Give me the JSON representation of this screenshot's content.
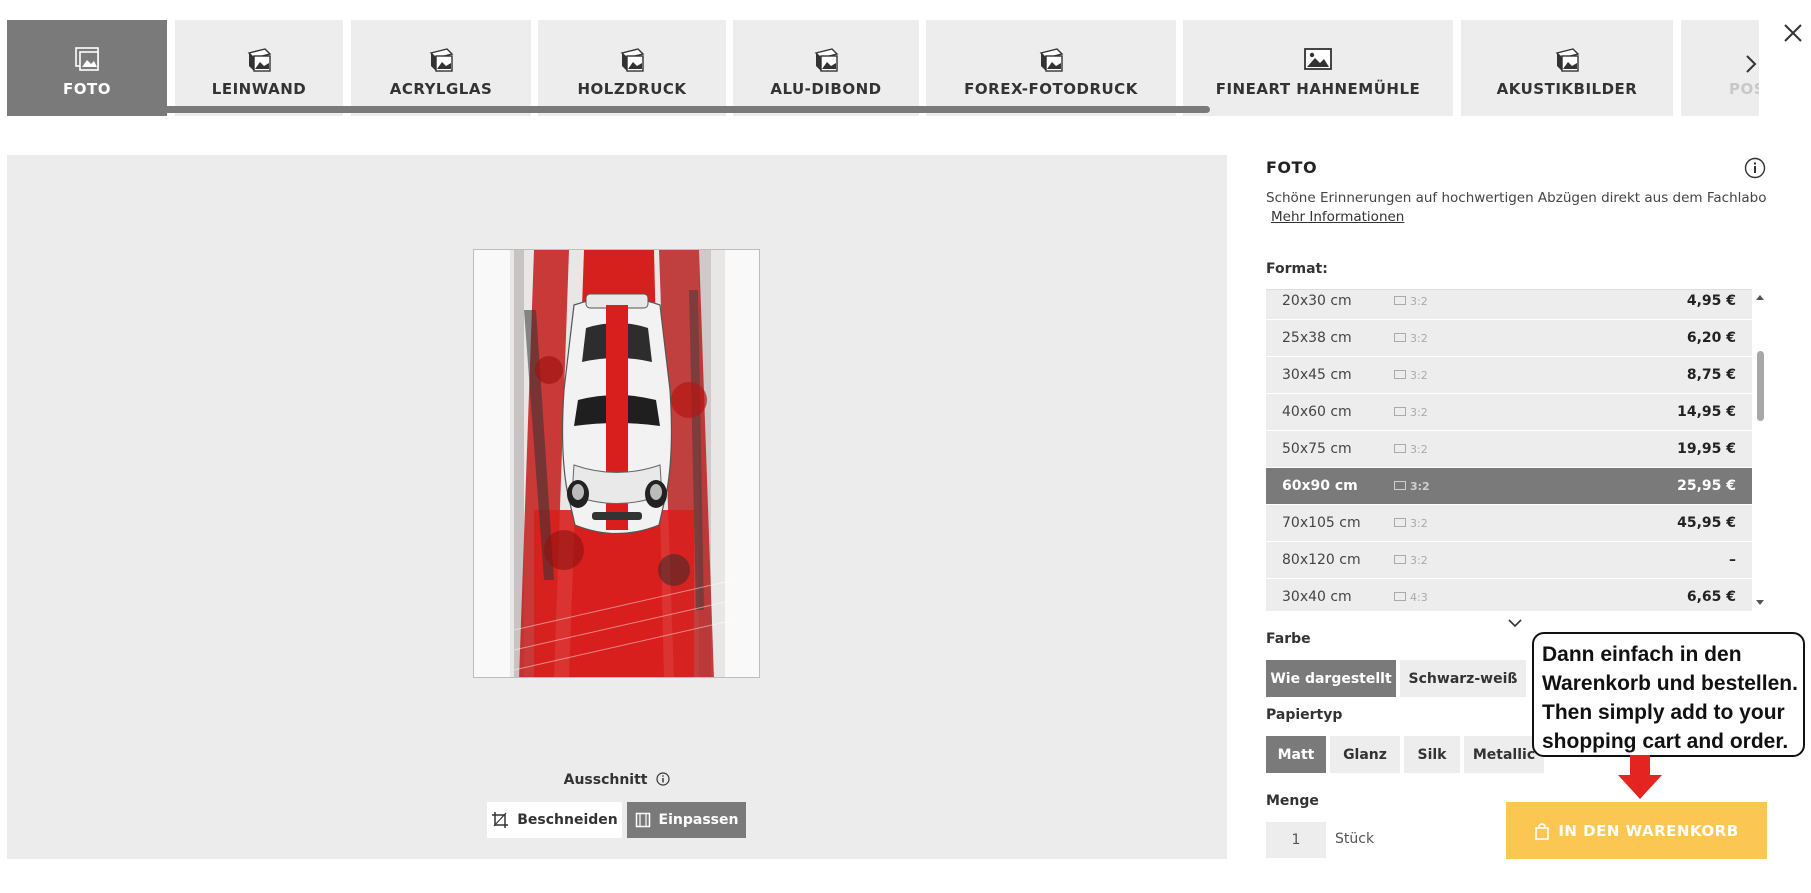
{
  "tabs": [
    {
      "label": "FOTO",
      "icon": "photo-stack-icon",
      "active": true
    },
    {
      "label": "LEINWAND",
      "icon": "canvas-icon"
    },
    {
      "label": "ACRYLGLAS",
      "icon": "acrylic-glass-icon"
    },
    {
      "label": "HOLZDRUCK",
      "icon": "wood-print-icon"
    },
    {
      "label": "ALU-DIBOND",
      "icon": "alu-dibond-icon"
    },
    {
      "label": "FOREX-FOTODRUCK",
      "icon": "forex-print-icon"
    },
    {
      "label": "FINEART HAHNEMÜHLE",
      "icon": "fineart-image-icon"
    },
    {
      "label": "AKUSTIKBILDER",
      "icon": "acoustic-image-icon"
    },
    {
      "label": "POS",
      "icon": "poster-icon"
    }
  ],
  "preview": {
    "crop_section_label": "Ausschnitt",
    "crop_button": "Beschneiden",
    "fit_button": "Einpassen"
  },
  "product": {
    "title": "FOTO",
    "description": "Schöne Erinnerungen auf hochwertigen Abzügen direkt aus dem Fachlabor. ...",
    "more_info": "Mehr Informationen",
    "format_label": "Format:",
    "formats": [
      {
        "size": "20x30 cm",
        "ratio": "3:2",
        "price": "4,95 €"
      },
      {
        "size": "25x38 cm",
        "ratio": "3:2",
        "price": "6,20 €"
      },
      {
        "size": "30x45 cm",
        "ratio": "3:2",
        "price": "8,75 €"
      },
      {
        "size": "40x60 cm",
        "ratio": "3:2",
        "price": "14,95 €"
      },
      {
        "size": "50x75 cm",
        "ratio": "3:2",
        "price": "19,95 €"
      },
      {
        "size": "60x90 cm",
        "ratio": "3:2",
        "price": "25,95 €",
        "selected": true
      },
      {
        "size": "70x105 cm",
        "ratio": "3:2",
        "price": "45,95 €"
      },
      {
        "size": "80x120 cm",
        "ratio": "3:2",
        "price": "–"
      },
      {
        "size": "30x40 cm",
        "ratio": "4:3",
        "price": "6,65 €"
      }
    ],
    "color_label": "Farbe",
    "color_options": [
      "Wie dargestellt",
      "Schwarz-weiß"
    ],
    "paper_label": "Papiertyp",
    "paper_options": [
      "Matt",
      "Glanz",
      "Silk",
      "Metallic"
    ],
    "quantity_label": "Menge",
    "quantity_value": "1",
    "quantity_unit": "Stück",
    "cart_button": "IN DEN WARENKORB"
  },
  "callout": {
    "lines": [
      "Dann einfach in den",
      "Warenkorb und bestellen.",
      "Then simply add to your",
      "shopping cart and order."
    ]
  },
  "colors": {
    "active_gray": "#7a7a7a",
    "tile_gray": "#ededed",
    "cart_yellow": "#fbc752",
    "arrow_red": "#e32420"
  }
}
